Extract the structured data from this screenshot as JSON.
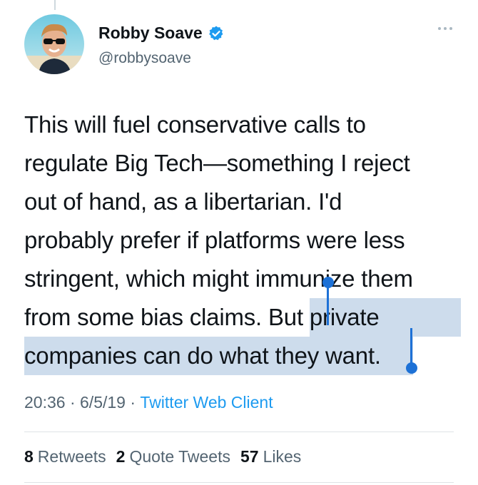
{
  "author": {
    "display_name": "Robby Soave",
    "handle": "@robbysoave",
    "verified": true,
    "avatar_icon": "profile-photo"
  },
  "tweet": {
    "text_plain": "This will fuel conservative calls to regulate Big Tech—something I reject out of hand, as a libertarian. I'd probably prefer if platforms were less stringent, which might immunize them from some bias claims. But ",
    "text_selected": "private companies can do what they want.",
    "lines": [
      "This will fuel conservative calls to",
      "regulate Big Tech—something I reject",
      "out of hand, as a libertarian. I'd",
      "probably prefer if platforms were less",
      "stringent, which might immunize them",
      "from some bias claims. But ",
      "private",
      "companies can do what they want."
    ]
  },
  "meta": {
    "time": "20:36",
    "sep1": " · ",
    "date": "6/5/19",
    "sep2": " · ",
    "source": "Twitter Web Client"
  },
  "stats": {
    "retweets_count": "8",
    "retweets_label": "Retweets",
    "quotes_count": "2",
    "quotes_label": "Quote Tweets",
    "likes_count": "57",
    "likes_label": "Likes"
  },
  "colors": {
    "link": "#1d9bf0",
    "selection": "#cddcec",
    "selection_handle": "#1d71d6",
    "secondary_text": "#536471"
  }
}
